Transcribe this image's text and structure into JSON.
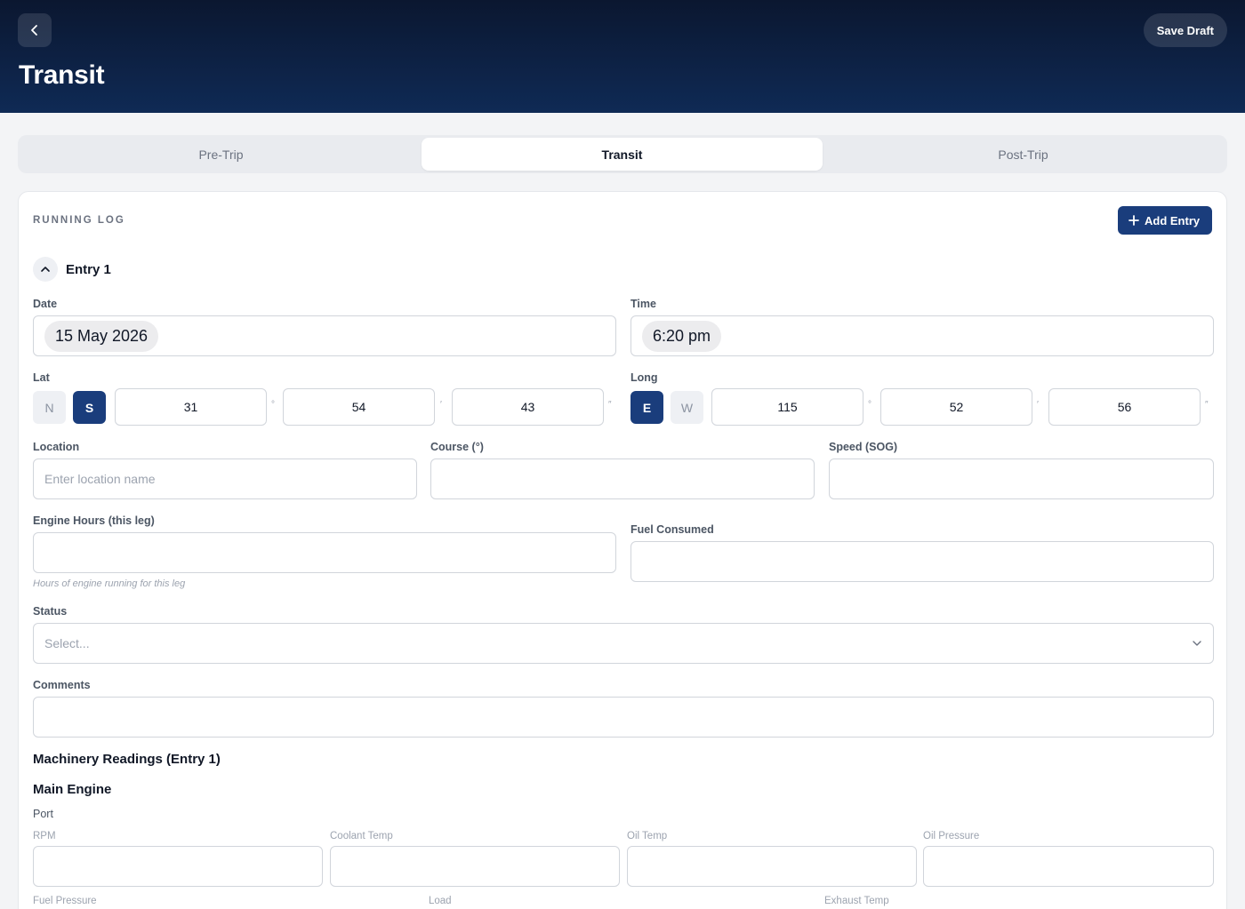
{
  "header": {
    "title": "Transit",
    "save_draft_label": "Save Draft",
    "back_icon": "chevron-left-icon"
  },
  "tabs": [
    {
      "label": "Pre-Trip",
      "active": false
    },
    {
      "label": "Transit",
      "active": true
    },
    {
      "label": "Post-Trip",
      "active": false
    }
  ],
  "running_log": {
    "section_title": "RUNNING LOG",
    "add_entry_label": "Add Entry",
    "entry": {
      "title": "Entry 1",
      "date_label": "Date",
      "date_value": "15 May 2026",
      "time_label": "Time",
      "time_value": "6:20 pm",
      "lat": {
        "label": "Lat",
        "hemispheres": [
          "N",
          "S"
        ],
        "selected": "S",
        "degrees": "31",
        "minutes": "54",
        "seconds": "43"
      },
      "long": {
        "label": "Long",
        "hemispheres": [
          "E",
          "W"
        ],
        "selected": "E",
        "degrees": "115",
        "minutes": "52",
        "seconds": "56"
      },
      "units": {
        "deg": "°",
        "min": "′",
        "sec": "″"
      },
      "location_label": "Location",
      "location_placeholder": "Enter location name",
      "course_label": "Course (°)",
      "speed_label": "Speed (SOG)",
      "engine_hours_label": "Engine Hours (this leg)",
      "engine_hours_hint": "Hours of engine running for this leg",
      "fuel_label": "Fuel Consumed",
      "status_label": "Status",
      "status_placeholder": "Select...",
      "comments_label": "Comments"
    }
  },
  "machinery": {
    "title": "Machinery Readings (Entry 1)",
    "main_engine_title": "Main Engine",
    "port_label": "Port",
    "row1": [
      "RPM",
      "Coolant Temp",
      "Oil Temp",
      "Oil Pressure"
    ],
    "row2": [
      "Fuel Pressure",
      "Load",
      "Exhaust Temp"
    ]
  },
  "colors": {
    "header_bg": "#0f2a55",
    "accent": "#1a3d7c"
  }
}
